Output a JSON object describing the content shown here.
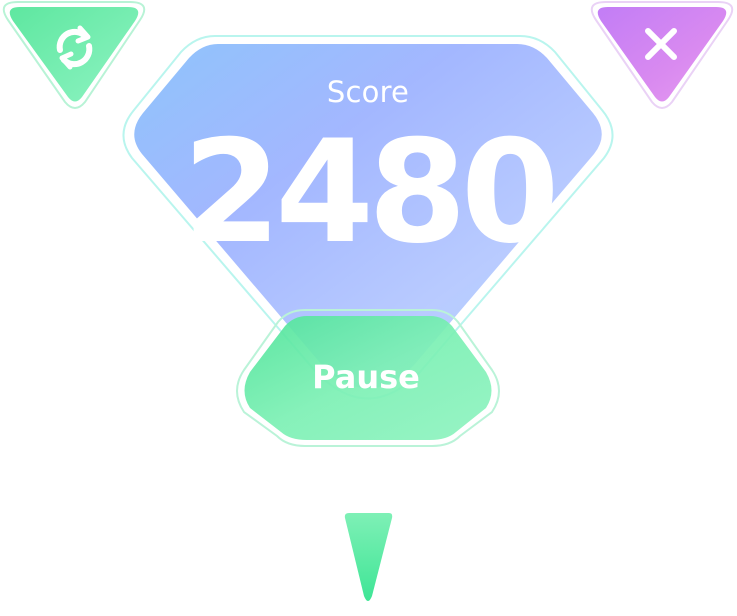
{
  "score": {
    "label": "Score",
    "value": "2480"
  },
  "pause_button": {
    "label": "Pause"
  },
  "top_left_button": {
    "icon": "restart-icon"
  },
  "top_right_button": {
    "icon": "close-icon"
  },
  "bottom_indicator": {
    "icon": "down-arrow-icon"
  },
  "colors": {
    "green": "#5eeaa0",
    "purple": "#c77bf2",
    "blue": "#9fc2ff",
    "outline": "#b9f5ee"
  }
}
